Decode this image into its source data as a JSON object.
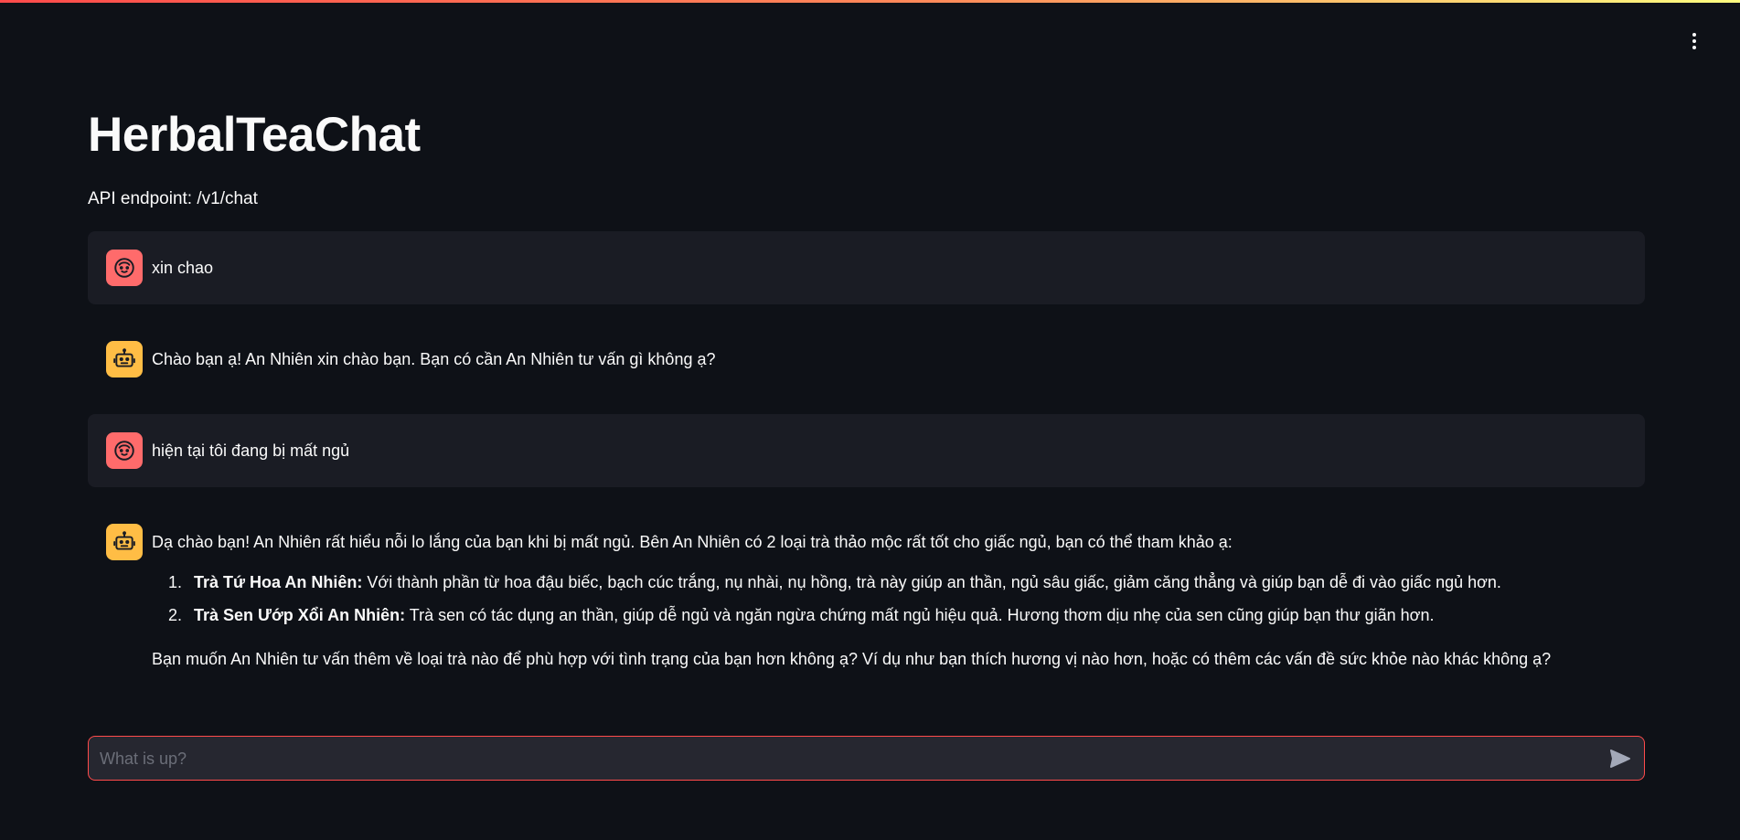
{
  "app": {
    "title": "HerbalTeaChat",
    "caption": "API endpoint: /v1/chat"
  },
  "colors": {
    "background": "#0e1117",
    "user_bubble": "#1a1c24",
    "user_avatar": "#ff6b6b",
    "bot_avatar": "#ffbd45",
    "input_border": "#ff4b4b",
    "input_background": "#262730"
  },
  "icons": {
    "menu": "vertical-ellipsis-icon",
    "user_avatar": "user-face-icon",
    "bot_avatar": "robot-icon",
    "send": "send-arrow-icon"
  },
  "messages": [
    {
      "role": "user",
      "text": "xin chao"
    },
    {
      "role": "assistant",
      "text": "Chào bạn ạ! An Nhiên xin chào bạn. Bạn có cần An Nhiên tư vấn gì không ạ?"
    },
    {
      "role": "user",
      "text": "hiện tại tôi đang bị mất ngủ"
    },
    {
      "role": "assistant",
      "intro": "Dạ chào bạn! An Nhiên rất hiểu nỗi lo lắng của bạn khi bị mất ngủ. Bên An Nhiên có 2 loại trà thảo mộc rất tốt cho giấc ngủ, bạn có thể tham khảo ạ:",
      "items": [
        {
          "name": "Trà Tứ Hoa An Nhiên:",
          "desc": " Với thành phần từ hoa đậu biếc, bạch cúc trắng, nụ nhài, nụ hồng, trà này giúp an thần, ngủ sâu giấc, giảm căng thẳng và giúp bạn dễ đi vào giấc ngủ hơn."
        },
        {
          "name": "Trà Sen Ướp Xổi An Nhiên:",
          "desc": " Trà sen có tác dụng an thần, giúp dễ ngủ và ngăn ngừa chứng mất ngủ hiệu quả. Hương thơm dịu nhẹ của sen cũng giúp bạn thư giãn hơn."
        }
      ],
      "outro": "Bạn muốn An Nhiên tư vấn thêm về loại trà nào để phù hợp với tình trạng của bạn hơn không ạ? Ví dụ như bạn thích hương vị nào hơn, hoặc có thêm các vấn đề sức khỏe nào khác không ạ?"
    }
  ],
  "chat_input": {
    "placeholder": "What is up?",
    "value": ""
  }
}
